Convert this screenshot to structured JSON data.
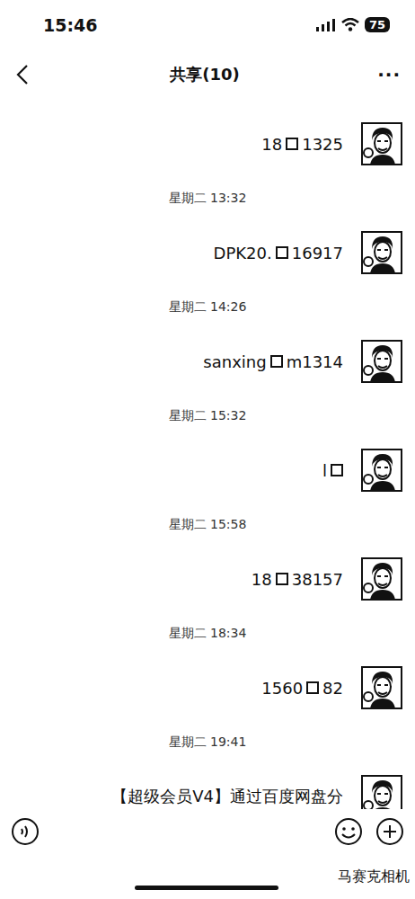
{
  "status": {
    "time": "15:46",
    "battery": "75"
  },
  "header": {
    "title": "共享(10)",
    "more": "···"
  },
  "messages": [
    {
      "parts": [
        "18",
        "1325"
      ],
      "time": "星期二 13:32"
    },
    {
      "parts": [
        "DPK20.",
        "16917"
      ],
      "time": "星期二 14:26"
    },
    {
      "parts": [
        "sanxing",
        "m1314"
      ],
      "time": "星期二 15:32"
    },
    {
      "parts": [
        "l"
      ],
      "time": "星期二 15:58"
    },
    {
      "parts": [
        "18",
        "38157"
      ],
      "time": "星期二 18:34"
    },
    {
      "parts": [
        "1560",
        "82"
      ],
      "time": "星期二 19:41"
    },
    {
      "parts": [
        "【超级会员V4】通过百度网盘分"
      ],
      "time": ""
    }
  ],
  "watermark": "马赛克相机"
}
